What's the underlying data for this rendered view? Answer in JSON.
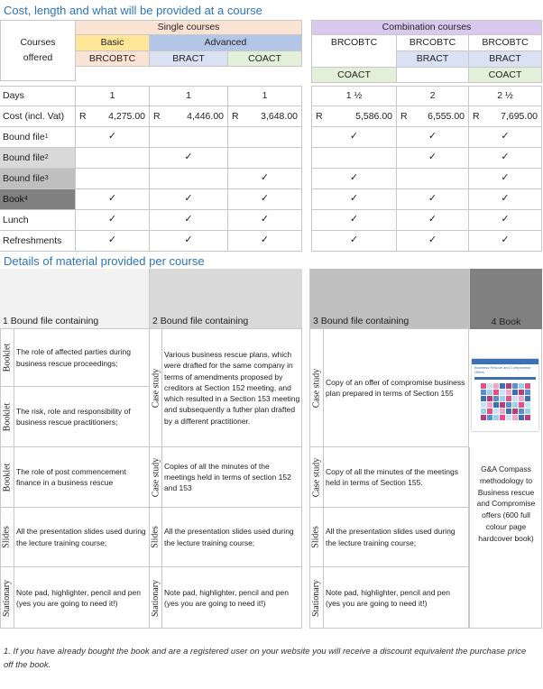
{
  "title1": "Cost, length and what will be provided at a course",
  "title2": "Details of material provided per course",
  "courses_offered": "Courses offered",
  "single_courses": "Single courses",
  "combination_courses": "Combination courses",
  "basic": "Basic",
  "advanced": "Advanced",
  "codes": {
    "brcobtc": "BRCOBTC",
    "bract": "BRACT",
    "coact": "COACT"
  },
  "rows": {
    "days": "Days",
    "cost": "Cost (incl. Vat)",
    "bound_file": "Bound file",
    "book": "Book",
    "lunch": "Lunch",
    "refreshments": "Refreshments"
  },
  "days": [
    "1",
    "1",
    "1",
    "1 ½",
    "2",
    "2 ½"
  ],
  "currency": "R",
  "costs": [
    "4,275.00",
    "4,446.00",
    "3,648.00",
    "5,586.00",
    "6,555.00",
    "7,695.00"
  ],
  "tick": "✓",
  "details": {
    "h1": "1 Bound file containing",
    "h2": "2 Bound file containing",
    "h3": "3 Bound file containing",
    "h4": "4 Book",
    "booklet": "Booklet",
    "case_study": "Case study",
    "slides": "Slides",
    "stationary": "Stationary",
    "c1_r1": "The role of affected parties during business rescue proceedings;",
    "c1_r2": "The risk, role and responsibility of business rescue practitioners;",
    "c1_r3": "The role of post commencement finance in a business rescue",
    "c2_r1": "Various business rescue plans, which were drafted for the same company in terms of amendments proposed by creditors at Section 152 meeting, and which resulted in a Section 153 meeting and subsequently a futher plan drafted by a different practitioner.",
    "c2_r3": "Copies of all the minutes of the meetings held in terms of section 152 and 153",
    "c3_r1": "Copy of an offer of compromise business plan prepared in terms of Section 155",
    "c3_r3": "Copy of all the minutes of the meetings held in terms of Section 155.",
    "slides_text": "All the presentation slides used during the lecture training course;",
    "stationary_text": "Note pad, highlighter, pencil and pen (yes you are going to need it!)",
    "book_desc": "G&A Compass methodology to Business rescue and Compromise offers (600 full colour page hardcover book)",
    "book_cover_title": "Business Rescue and Compromise Offers"
  },
  "footnote": "1. If you have already bought the book and are a registered user on your website you will receive a discount equivalent the purchase price off the book.",
  "colors": {
    "accent": "#2e75b6",
    "single": "#fbe3d4",
    "combo": "#d9c9ee",
    "basic": "#ffe699",
    "advanced": "#b4c6e7",
    "bract": "#dae1f3",
    "coact": "#e2efd9",
    "grey1": "#d9d9d9",
    "grey2": "#bfbfbf",
    "grey3": "#808080"
  }
}
